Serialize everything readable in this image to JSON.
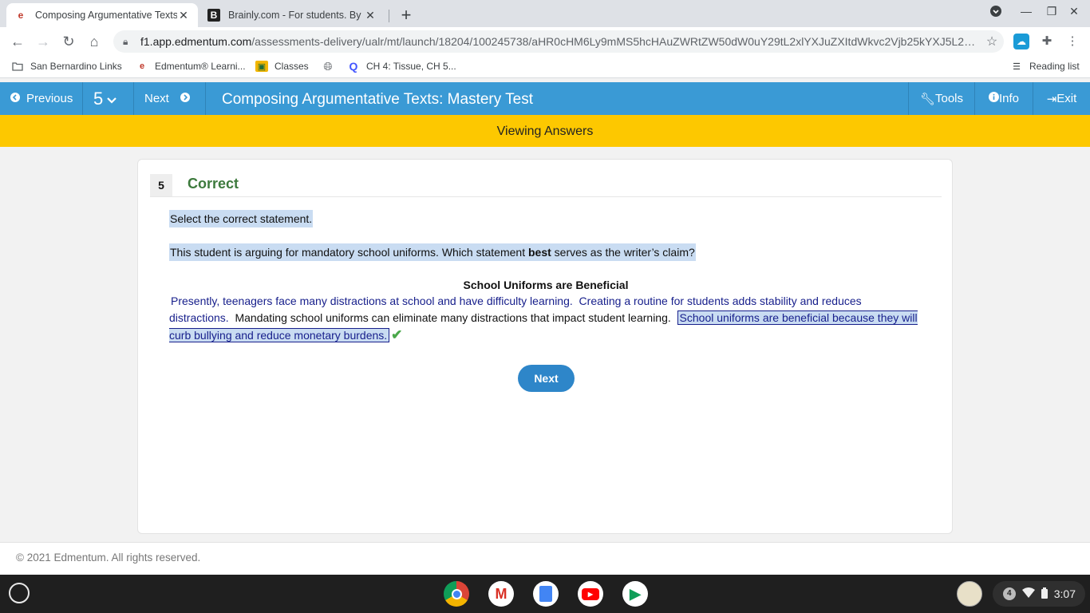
{
  "browser": {
    "tabs": [
      {
        "title": "Composing Argumentative Texts: Mastery Test",
        "favicon": "edmentum-icon",
        "active": true
      },
      {
        "title": "Brainly.com - For students. By students.",
        "favicon": "brainly-icon",
        "active": false
      }
    ],
    "url_host": "f1.app.edmentum.com",
    "url_path": "/assessments-delivery/ualr/mt/launch/18204/100245738/aHR0cHM6Ly9mMS5hcHAuZWRtZW50dW0uY29tL2xlYXJuZXItdWkvc2Vjb25kYXJ5L2…",
    "bookmarks": [
      {
        "label": "San Bernardino Links",
        "icon": "folder-icon"
      },
      {
        "label": "Edmentum® Learni...",
        "icon": "edmentum-icon"
      },
      {
        "label": "Classes",
        "icon": "classroom-icon"
      },
      {
        "label": "",
        "icon": "globe-icon"
      },
      {
        "label": "CH 4: Tissue, CH 5...",
        "icon": "quizlet-icon"
      }
    ],
    "reading_list": "Reading list"
  },
  "header": {
    "previous_label": "Previous",
    "question_selector": "5",
    "next_label": "Next",
    "title": "Composing Argumentative Texts: Mastery Test",
    "tools_label": "Tools",
    "info_label": "Info",
    "exit_label": "Exit",
    "color": "#3a9ad5"
  },
  "banner": {
    "text": "Viewing Answers",
    "color": "#fdc800"
  },
  "question": {
    "number": "5",
    "status": "Correct",
    "instruction": "Select the correct statement.",
    "prompt_before": "This student is arguing for mandatory school uniforms. Which statement ",
    "prompt_bold": "best",
    "prompt_after": " serves as the writer’s claim?",
    "passage_title": "School Uniforms are Beneficial",
    "passage": {
      "s1": "Presently, teenagers face many distractions at school and have difficulty learning.",
      "s2": "Creating a routine for students adds stability and reduces distractions.",
      "s3": "Mandating school uniforms can eliminate many distractions that impact student learning.",
      "s4": "School uniforms are beneficial because they will curb bullying and reduce monetary burdens."
    },
    "next_button": "Next"
  },
  "footer": {
    "copyright": "© 2021 Edmentum. All rights reserved."
  },
  "shelf": {
    "notification_count": "4",
    "time": "3:07"
  }
}
